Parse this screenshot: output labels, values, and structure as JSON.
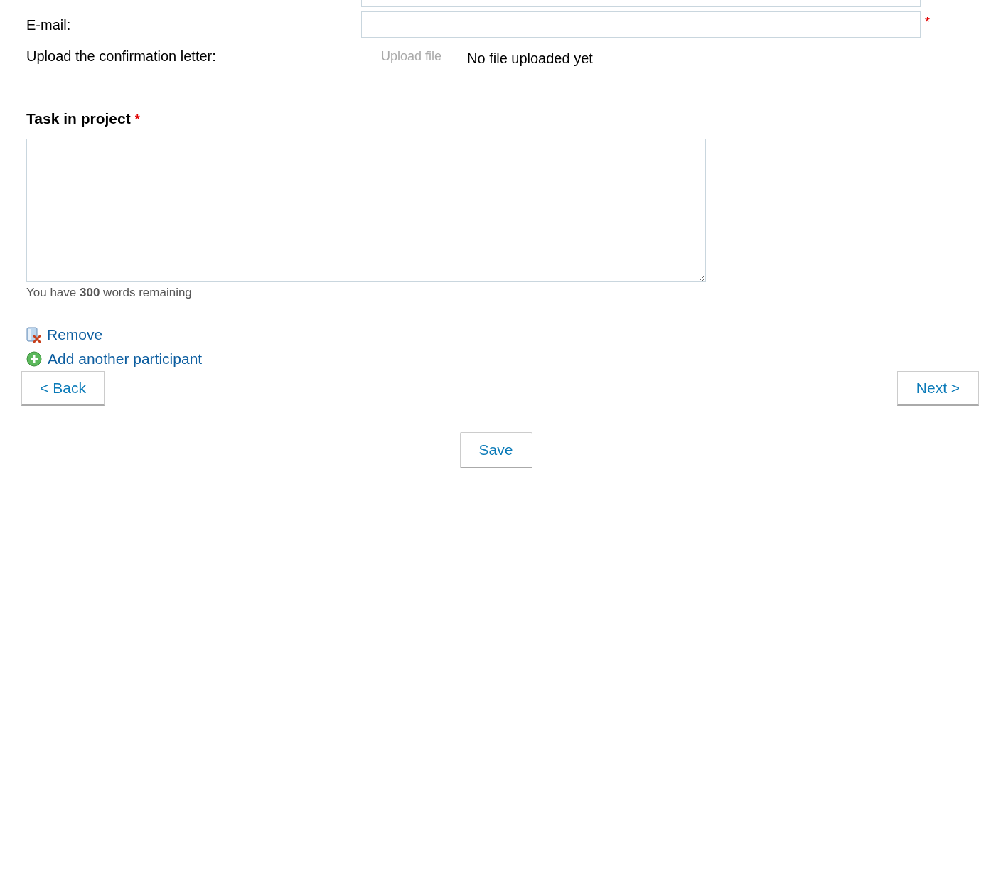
{
  "fields": [
    {
      "kind": "text"
    },
    {
      "kind": "text",
      "label": "E-mail:",
      "required_mark": "*"
    },
    {
      "kind": "upload",
      "label": "Upload the confirmation letter:",
      "button": {
        "label": "Upload file",
        "disabled": true
      },
      "status": "No file uploaded yet"
    }
  ],
  "task": {
    "title": "Task in project",
    "required_mark": "*",
    "counter": "You have **300** words remaining"
  },
  "links": [
    {
      "kind": "remove",
      "label": "Remove"
    },
    {
      "kind": "add",
      "label": "Add another participant"
    }
  ],
  "nav": {
    "back": "< Back",
    "next": "Next >",
    "save": "Save"
  }
}
